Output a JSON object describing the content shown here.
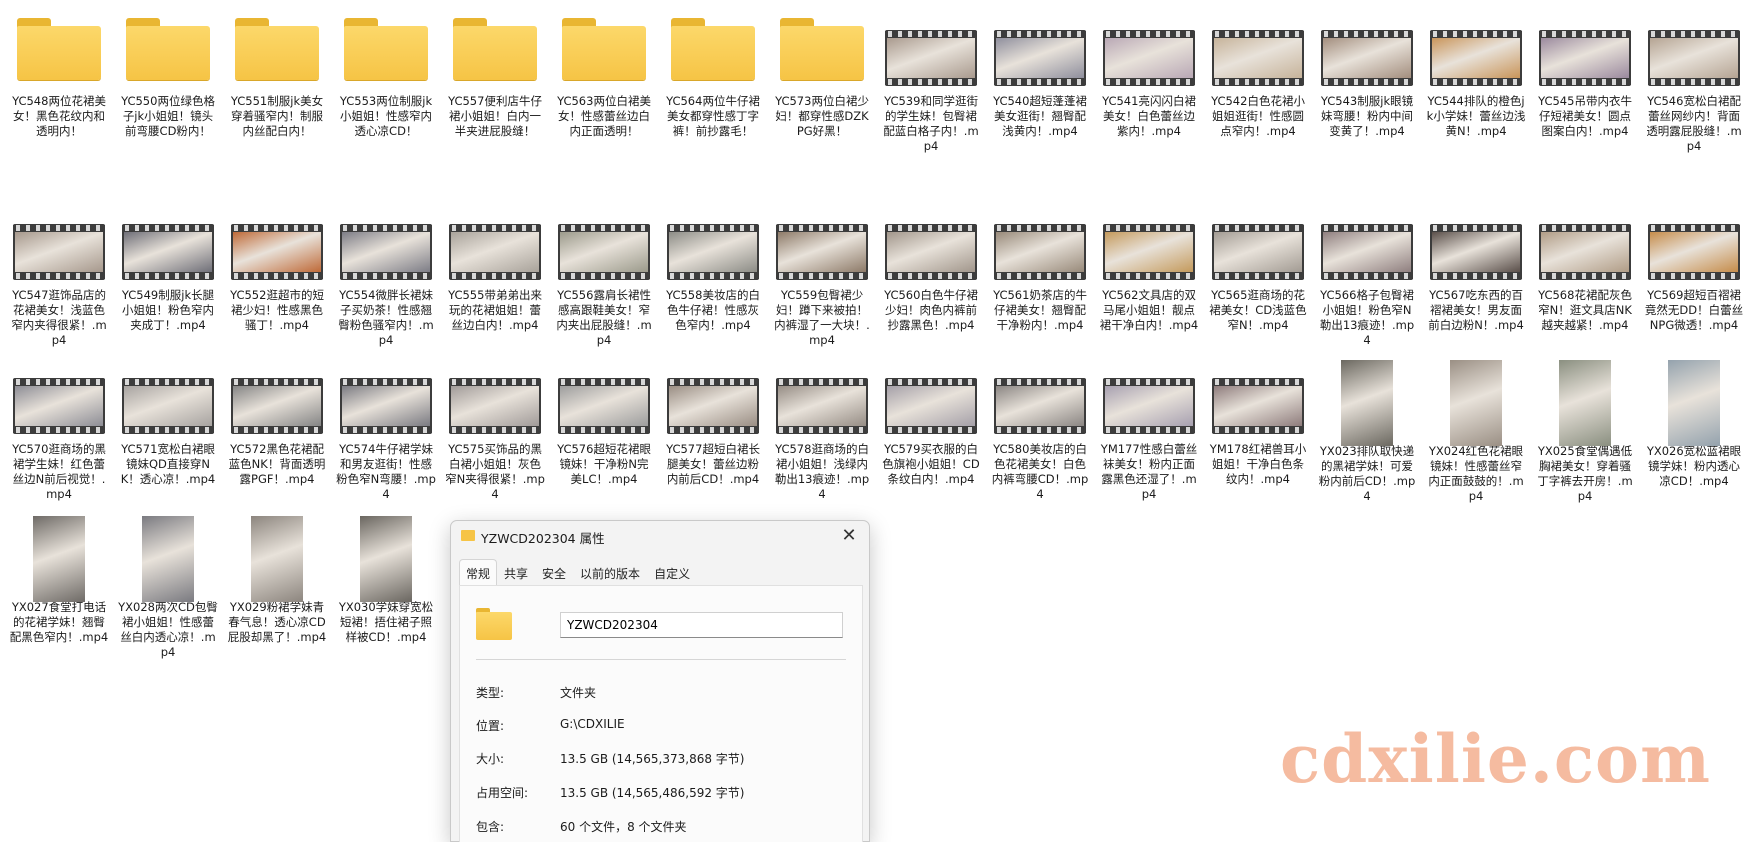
{
  "files": [
    {
      "kind": "folder",
      "name": "YC548两位花裙美女！黑色花纹内和透明内！"
    },
    {
      "kind": "folder",
      "name": "YC550两位绿色格子jk小姐姐！镜头前弯腰CD粉内！"
    },
    {
      "kind": "folder",
      "name": "YC551制服jk美女穿着骚窄内！制服内丝配白内！"
    },
    {
      "kind": "folder",
      "name": "YC553两位制服jk小姐姐！性感窄内透心凉CD！"
    },
    {
      "kind": "folder",
      "name": "YC557便利店牛仔裙小姐姐！白内一半夹进屁股缝！"
    },
    {
      "kind": "folder",
      "name": "YC563两位白裙美女！性感蕾丝边白内正面透明！"
    },
    {
      "kind": "folder",
      "name": "YC564两位牛仔裙美女都穿性感丁字裤！前抄露毛！"
    },
    {
      "kind": "folder",
      "name": "YC573两位白裙少妇！都穿性感DZKPG好黑！"
    },
    {
      "kind": "video",
      "name": "YC539和同学逛街的学生妹！包臀裙配蓝白格子内！.mp4",
      "c": "#a99a8e"
    },
    {
      "kind": "video",
      "name": "YC540超短蓬蓬裙美女逛街！翘臀配浅黄内！.mp4",
      "c": "#8f8f9d"
    },
    {
      "kind": "video",
      "name": "YC541亮闪闪白裙美女！白色蕾丝边紫内！.mp4",
      "c": "#b9a8b5"
    },
    {
      "kind": "video",
      "name": "YC542白色花裙小姐姐逛街！性感圆点窄内！.mp4",
      "c": "#c6b39a"
    },
    {
      "kind": "video",
      "name": "YC543制服jk眼镜妹弯腰！粉内中间变黄了！.mp4",
      "c": "#a38e7e"
    },
    {
      "kind": "video",
      "name": "YC544排队的橙色jk小学妹！蕾丝边浅黄N！.mp4",
      "c": "#c9955a"
    },
    {
      "kind": "video",
      "name": "YC545吊带内衣牛仔短裙美女！圆点图案白内！.mp4",
      "c": "#9b8a9e"
    },
    {
      "kind": "video",
      "name": "YC546宽松白裙配蕾丝网纱内！背面透明露屁股缝！.mp4",
      "c": "#b5a493"
    },
    {
      "kind": "video",
      "name": "YC547逛饰品店的花裙美女！浅蓝色窄内夹得很紧！.mp4",
      "c": "#a6988c"
    },
    {
      "kind": "video",
      "name": "YC549制服jk长腿小姐姐！粉色窄内夹成丁！.mp4",
      "c": "#6f6f78"
    },
    {
      "kind": "video",
      "name": "YC552逛超市的短裙少妇！性感黑色骚丁！.mp4",
      "c": "#bf6a38"
    },
    {
      "kind": "video",
      "name": "YC554微胖长裙妹子买奶茶！性感翘臀粉色骚窄内！.mp4",
      "c": "#7d7d86"
    },
    {
      "kind": "video",
      "name": "YC555带弟弟出来玩的花裙姐姐！蕾丝边白内！.mp4",
      "c": "#a8a29a"
    },
    {
      "kind": "video",
      "name": "YC556露肩长裙性感高跟鞋美女！窄内夹出屁股缝！.mp4",
      "c": "#9b9a8b"
    },
    {
      "kind": "video",
      "name": "YC558美妆店的白色牛仔裙！性感灰色窄内！.mp4",
      "c": "#8c8c86"
    },
    {
      "kind": "video",
      "name": "YC559包臀裙少妇！蹲下来被拍！内裤湿了一大块！.mp4",
      "c": "#8d7a68"
    },
    {
      "kind": "video",
      "name": "YC560白色牛仔裙少妇！肉色内裤前抄露黑色！.mp4",
      "c": "#a1968b"
    },
    {
      "kind": "video",
      "name": "YC561奶茶店的牛仔裙美女！翘臀配干净粉内！.mp4",
      "c": "#988a7a"
    },
    {
      "kind": "video",
      "name": "YC562文具店的双马尾小姐姐！靓点裙干净白内！.mp4",
      "c": "#c49a5c"
    },
    {
      "kind": "video",
      "name": "YC565逛商场的花裙美女！CD浅蓝色窄N！.mp4",
      "c": "#a29b93"
    },
    {
      "kind": "video",
      "name": "YC566格子包臀裙小姐姐！粉色窄N勒出13痕迹！.mp4",
      "c": "#8f7f7f"
    },
    {
      "kind": "video",
      "name": "YC567吃东西的百褶裙美女！男友面前白边粉N！.mp4",
      "c": "#5a4f4a"
    },
    {
      "kind": "video",
      "name": "YC568花裙配灰色窄N！逛文具店NK越夹越紧！.mp4",
      "c": "#b09c86"
    },
    {
      "kind": "video",
      "name": "YC569超短百褶裙竟然无DD！白蕾丝NPG微透！.mp4",
      "c": "#c58c4a"
    },
    {
      "kind": "video",
      "name": "YC570逛商场的黑裙学生妹！红色蕾丝边N前后视觉！.mp4",
      "c": "#8d8d95"
    },
    {
      "kind": "video",
      "name": "YC571宽松白裙眼镜妹QD直接穿NK！透心凉！.mp4",
      "c": "#a7a3a0"
    },
    {
      "kind": "video",
      "name": "YC572黑色花裙配蓝色NK！背面透明露PGF！.mp4",
      "c": "#858585"
    },
    {
      "kind": "video",
      "name": "YC574牛仔裙学妹和男友逛街！性感粉色窄N弯腰！.mp4",
      "c": "#7b7b82"
    },
    {
      "kind": "video",
      "name": "YC575买饰品的黑白裙小姐姐！灰色窄N夹得很紧！.mp4",
      "c": "#a19b99"
    },
    {
      "kind": "video",
      "name": "YC576超短花裙眼镜妹！干净粉N完美LC！.mp4",
      "c": "#9d9d9d"
    },
    {
      "kind": "video",
      "name": "YC577超短白裙长腿美女！蕾丝边粉内前后CD！.mp4",
      "c": "#9a8e84"
    },
    {
      "kind": "video",
      "name": "YC578逛商场的白裙小姐姐！浅绿内勒出13痕迹！.mp4",
      "c": "#968d85"
    },
    {
      "kind": "video",
      "name": "YC579买衣服的白色旗袍小姐姐！CD条纹白内！.mp4",
      "c": "#a5a0a8"
    },
    {
      "kind": "video",
      "name": "YC580美妆店的白色花裙美女！白色内裤弯腰CD！.mp4",
      "c": "#8b8683"
    },
    {
      "kind": "video",
      "name": "YM177性感白蕾丝袜美女！粉内正面露黑色还湿了！.mp4",
      "c": "#a7a0b0"
    },
    {
      "kind": "video",
      "name": "YM178红裙兽耳小姐姐！干净白色条纹内！.mp4",
      "c": "#8e7c7c"
    },
    {
      "kind": "tall",
      "name": "YX023排队取快递的黑裙学妹！可爱粉内前后CD！.mp4",
      "c": "#6b6860"
    },
    {
      "kind": "tall",
      "name": "YX024红色花裙眼镜妹！性感蕾丝窄内正面鼓鼓的！.mp4",
      "c": "#9a8f84"
    },
    {
      "kind": "tall",
      "name": "YX025食堂偶遇低胸裙美女！穿着骚丁字裤去开房！.mp4",
      "c": "#8a8f80"
    },
    {
      "kind": "tall",
      "name": "YX026宽松蓝裙眼镜学妹！粉内透心凉CD！.mp4",
      "c": "#94a2ad"
    },
    {
      "kind": "tall",
      "name": "YX027食堂打电话的花裙学妹！翘臀配黑色窄内！.mp4",
      "c": "#6e6a66"
    },
    {
      "kind": "tall",
      "name": "YX028两次CD包臀裙小姐姐！性感蕾丝白内透心凉！.mp4",
      "c": "#7a7a80"
    },
    {
      "kind": "tall",
      "name": "YX029粉裙学妹青春气息！透心凉CD屁股却黑了！.mp4",
      "c": "#8c857e"
    },
    {
      "kind": "tall",
      "name": "YX030学妹穿宽松短裙！捂住裙子照样被CD！.mp4",
      "c": "#6a6660"
    }
  ],
  "dialog": {
    "title": "YZWCD202304 属性",
    "close": "✕",
    "tabs": [
      "常规",
      "共享",
      "安全",
      "以前的版本",
      "自定义"
    ],
    "name_value": "YZWCD202304",
    "props": [
      {
        "k": "类型:",
        "v": "文件夹"
      },
      {
        "k": "位置:",
        "v": "G:\\CDXILIE"
      },
      {
        "k": "大小:",
        "v": "13.5 GB (14,565,373,868 字节)"
      },
      {
        "k": "占用空间:",
        "v": "13.5 GB (14,565,486,592 字节)"
      },
      {
        "k": "包含:",
        "v": "60 个文件，8 个文件夹"
      }
    ]
  },
  "watermark": "cdxilie.com"
}
